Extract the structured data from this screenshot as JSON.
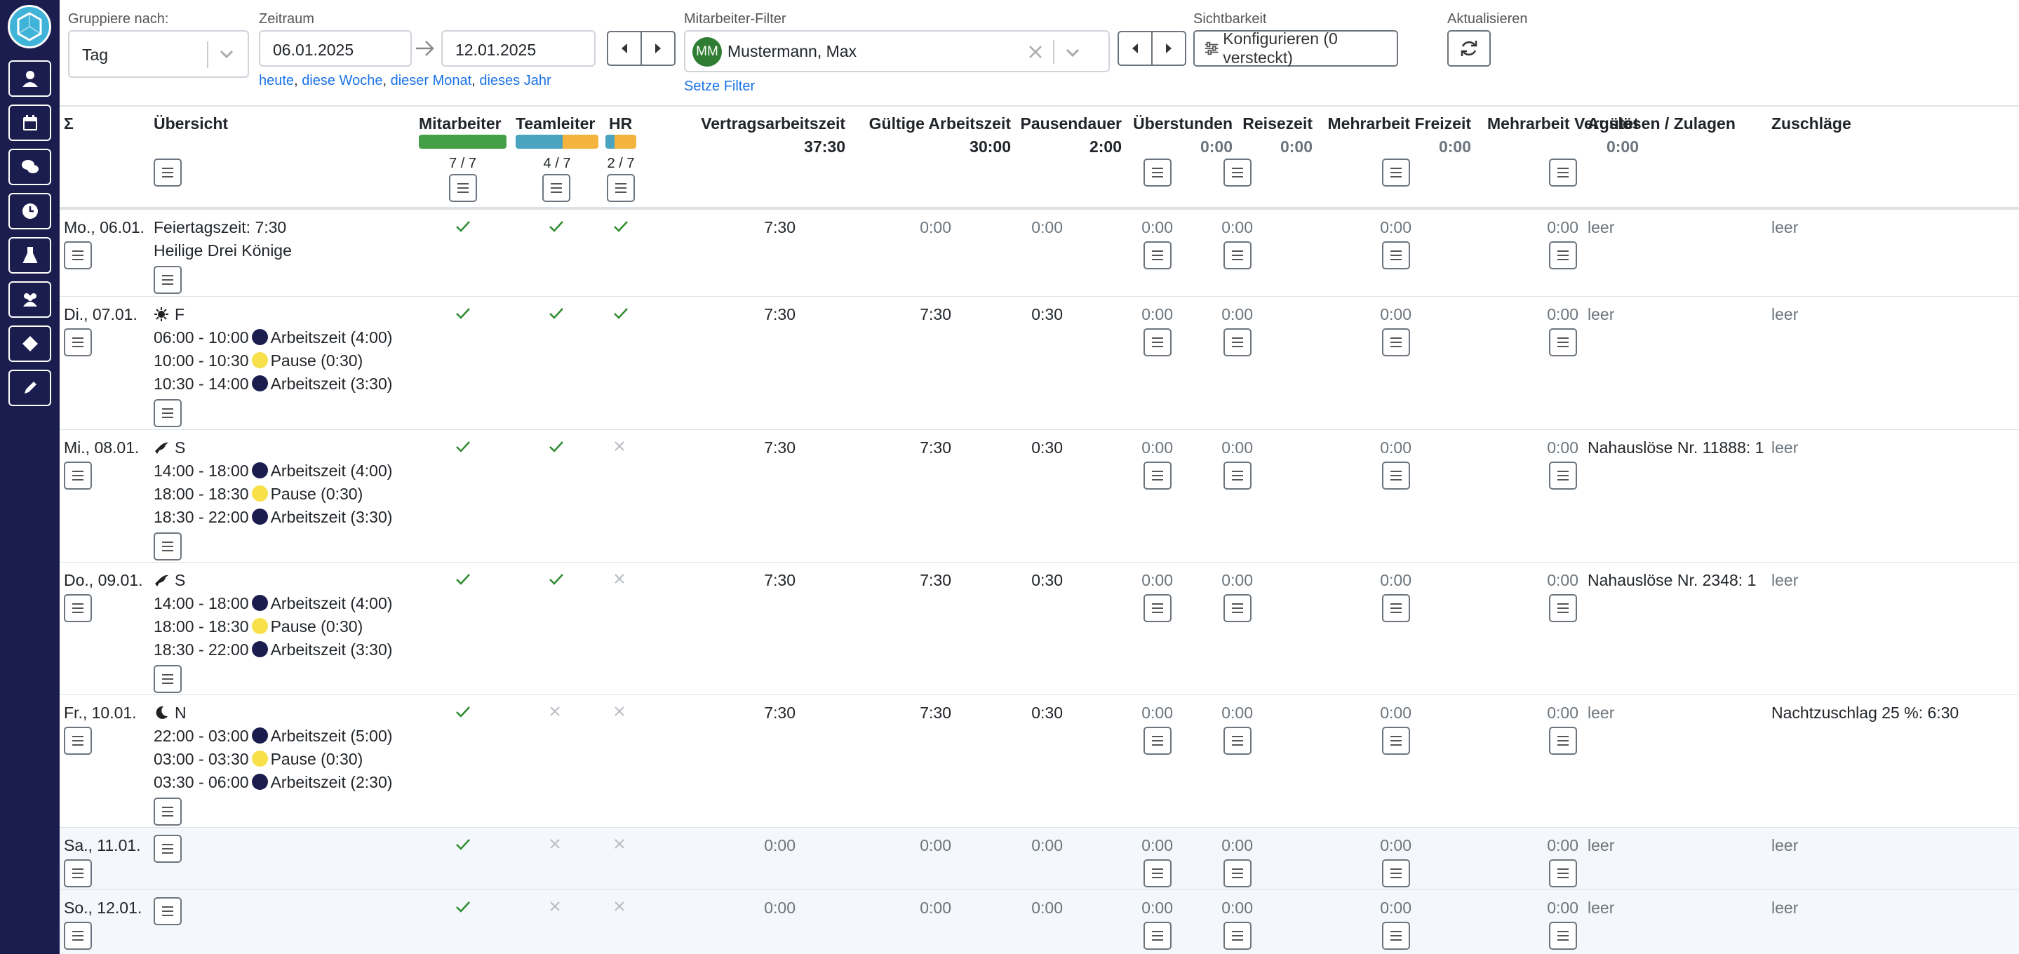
{
  "colors": {
    "sidebar": "#1a1d4e",
    "accent": "#1a73e8",
    "check": "#2e8b2e",
    "work": "#1a1d4e",
    "pause": "#f7e04a",
    "bar_green": "#43a047",
    "bar_blue": "#4aa3bf",
    "bar_yellow": "#f3b33d"
  },
  "sidebar": {
    "items": [
      "user-icon",
      "calendar-icon",
      "chat-icon",
      "clock-icon",
      "flask-icon",
      "users-icon",
      "diamond-icon",
      "pen-icon"
    ]
  },
  "toolbar": {
    "group_label": "Gruppiere nach:",
    "group_value": "Tag",
    "period_label": "Zeitraum",
    "date_from": "06.01.2025",
    "date_to": "12.01.2025",
    "quick_links": [
      "heute",
      "diese Woche",
      "dieser Monat",
      "dieses Jahr"
    ],
    "employee_filter_label": "Mitarbeiter-Filter",
    "employee_avatar": "MM",
    "employee_name": "Mustermann, Max",
    "set_filter": "Setze Filter",
    "visibility_label": "Sichtbarkeit",
    "configure_label": "Konfigurieren (0 versteckt)",
    "refresh_label": "Aktualisieren"
  },
  "columns": {
    "sum": "Σ",
    "overview": "Übersicht",
    "employee": "Mitarbeiter",
    "teamlead": "Teamleiter",
    "hr": "HR",
    "contract": "Vertragsarbeitszeit",
    "valid": "Gültige Arbeitszeit",
    "pause": "Pausendauer",
    "overtime": "Überstunden",
    "travel": "Reisezeit",
    "extra_free": "Mehrarbeit Freizeit",
    "extra_paid": "Mehrarbeit Vergütet",
    "allowances": "Auslösen / Zulagen",
    "surcharges": "Zuschläge"
  },
  "totals": {
    "employee_count": "7 / 7",
    "teamlead_count": "4 / 7",
    "hr_count": "2 / 7",
    "employee_fraction": 1.0,
    "teamlead_fraction": 0.571,
    "hr_fraction": 0.286,
    "contract": "37:30",
    "valid": "30:00",
    "pause": "2:00",
    "overtime": "0:00",
    "travel": "0:00",
    "extra_free": "0:00",
    "extra_paid": "0:00"
  },
  "rows": [
    {
      "day": "Mo., 06.01.",
      "shift_icon": "",
      "shift": "",
      "lines": [
        {
          "text": "Feiertagszeit: 7:30",
          "dot": ""
        },
        {
          "text": "Heilige Drei Könige",
          "dot": ""
        }
      ],
      "emp": "check",
      "tl": "check",
      "hr": "check",
      "contract": "7:30",
      "valid": "0:00",
      "pause": "0:00",
      "overtime": "0:00",
      "travel": "0:00",
      "extra_free": "0:00",
      "extra_paid": "0:00",
      "allow": "leer",
      "surch": "leer"
    },
    {
      "day": "Di., 07.01.",
      "shift_icon": "sun-icon",
      "shift": "F",
      "lines": [
        {
          "text": "06:00 - 10:00",
          "dot": "work",
          "label": "Arbeitszeit (4:00)"
        },
        {
          "text": "10:00 - 10:30",
          "dot": "pause",
          "label": "Pause (0:30)"
        },
        {
          "text": "10:30 - 14:00",
          "dot": "work",
          "label": "Arbeitszeit (3:30)"
        }
      ],
      "emp": "check",
      "tl": "check",
      "hr": "check",
      "contract": "7:30",
      "valid": "7:30",
      "pause": "0:30",
      "overtime": "0:00",
      "travel": "0:00",
      "extra_free": "0:00",
      "extra_paid": "0:00",
      "allow": "leer",
      "surch": "leer"
    },
    {
      "day": "Mi., 08.01.",
      "shift_icon": "crow-icon",
      "shift": "S",
      "lines": [
        {
          "text": "14:00 - 18:00",
          "dot": "work",
          "label": "Arbeitszeit (4:00)"
        },
        {
          "text": "18:00 - 18:30",
          "dot": "pause",
          "label": "Pause (0:30)"
        },
        {
          "text": "18:30 - 22:00",
          "dot": "work",
          "label": "Arbeitszeit (3:30)"
        }
      ],
      "emp": "check",
      "tl": "check",
      "hr": "cross",
      "contract": "7:30",
      "valid": "7:30",
      "pause": "0:30",
      "overtime": "0:00",
      "travel": "0:00",
      "extra_free": "0:00",
      "extra_paid": "0:00",
      "allow": "Nahauslöse Nr. 11888: 1",
      "surch": "leer"
    },
    {
      "day": "Do., 09.01.",
      "shift_icon": "crow-icon",
      "shift": "S",
      "lines": [
        {
          "text": "14:00 - 18:00",
          "dot": "work",
          "label": "Arbeitszeit (4:00)"
        },
        {
          "text": "18:00 - 18:30",
          "dot": "pause",
          "label": "Pause (0:30)"
        },
        {
          "text": "18:30 - 22:00",
          "dot": "work",
          "label": "Arbeitszeit (3:30)"
        }
      ],
      "emp": "check",
      "tl": "check",
      "hr": "cross",
      "contract": "7:30",
      "valid": "7:30",
      "pause": "0:30",
      "overtime": "0:00",
      "travel": "0:00",
      "extra_free": "0:00",
      "extra_paid": "0:00",
      "allow": "Nahauslöse Nr. 2348: 1",
      "surch": "leer"
    },
    {
      "day": "Fr., 10.01.",
      "shift_icon": "moon-icon",
      "shift": "N",
      "lines": [
        {
          "text": "22:00 - 03:00",
          "dot": "work",
          "label": "Arbeitszeit (5:00)"
        },
        {
          "text": "03:00 - 03:30",
          "dot": "pause",
          "label": "Pause (0:30)"
        },
        {
          "text": "03:30 - 06:00",
          "dot": "work",
          "label": "Arbeitszeit (2:30)"
        }
      ],
      "emp": "check",
      "tl": "cross",
      "hr": "cross",
      "contract": "7:30",
      "valid": "7:30",
      "pause": "0:30",
      "overtime": "0:00",
      "travel": "0:00",
      "extra_free": "0:00",
      "extra_paid": "0:00",
      "allow": "leer",
      "surch": "Nachtzuschlag 25 %: 6:30"
    },
    {
      "day": "Sa., 11.01.",
      "shift_icon": "",
      "shift": "",
      "lines": [],
      "emp": "check",
      "tl": "cross",
      "hr": "cross",
      "contract": "0:00",
      "valid": "0:00",
      "pause": "0:00",
      "overtime": "0:00",
      "travel": "0:00",
      "extra_free": "0:00",
      "extra_paid": "0:00",
      "allow": "leer",
      "surch": "leer"
    },
    {
      "day": "So., 12.01.",
      "shift_icon": "",
      "shift": "",
      "lines": [],
      "emp": "check",
      "tl": "cross",
      "hr": "cross",
      "contract": "0:00",
      "valid": "0:00",
      "pause": "0:00",
      "overtime": "0:00",
      "travel": "0:00",
      "extra_free": "0:00",
      "extra_paid": "0:00",
      "allow": "leer",
      "surch": "leer"
    }
  ]
}
